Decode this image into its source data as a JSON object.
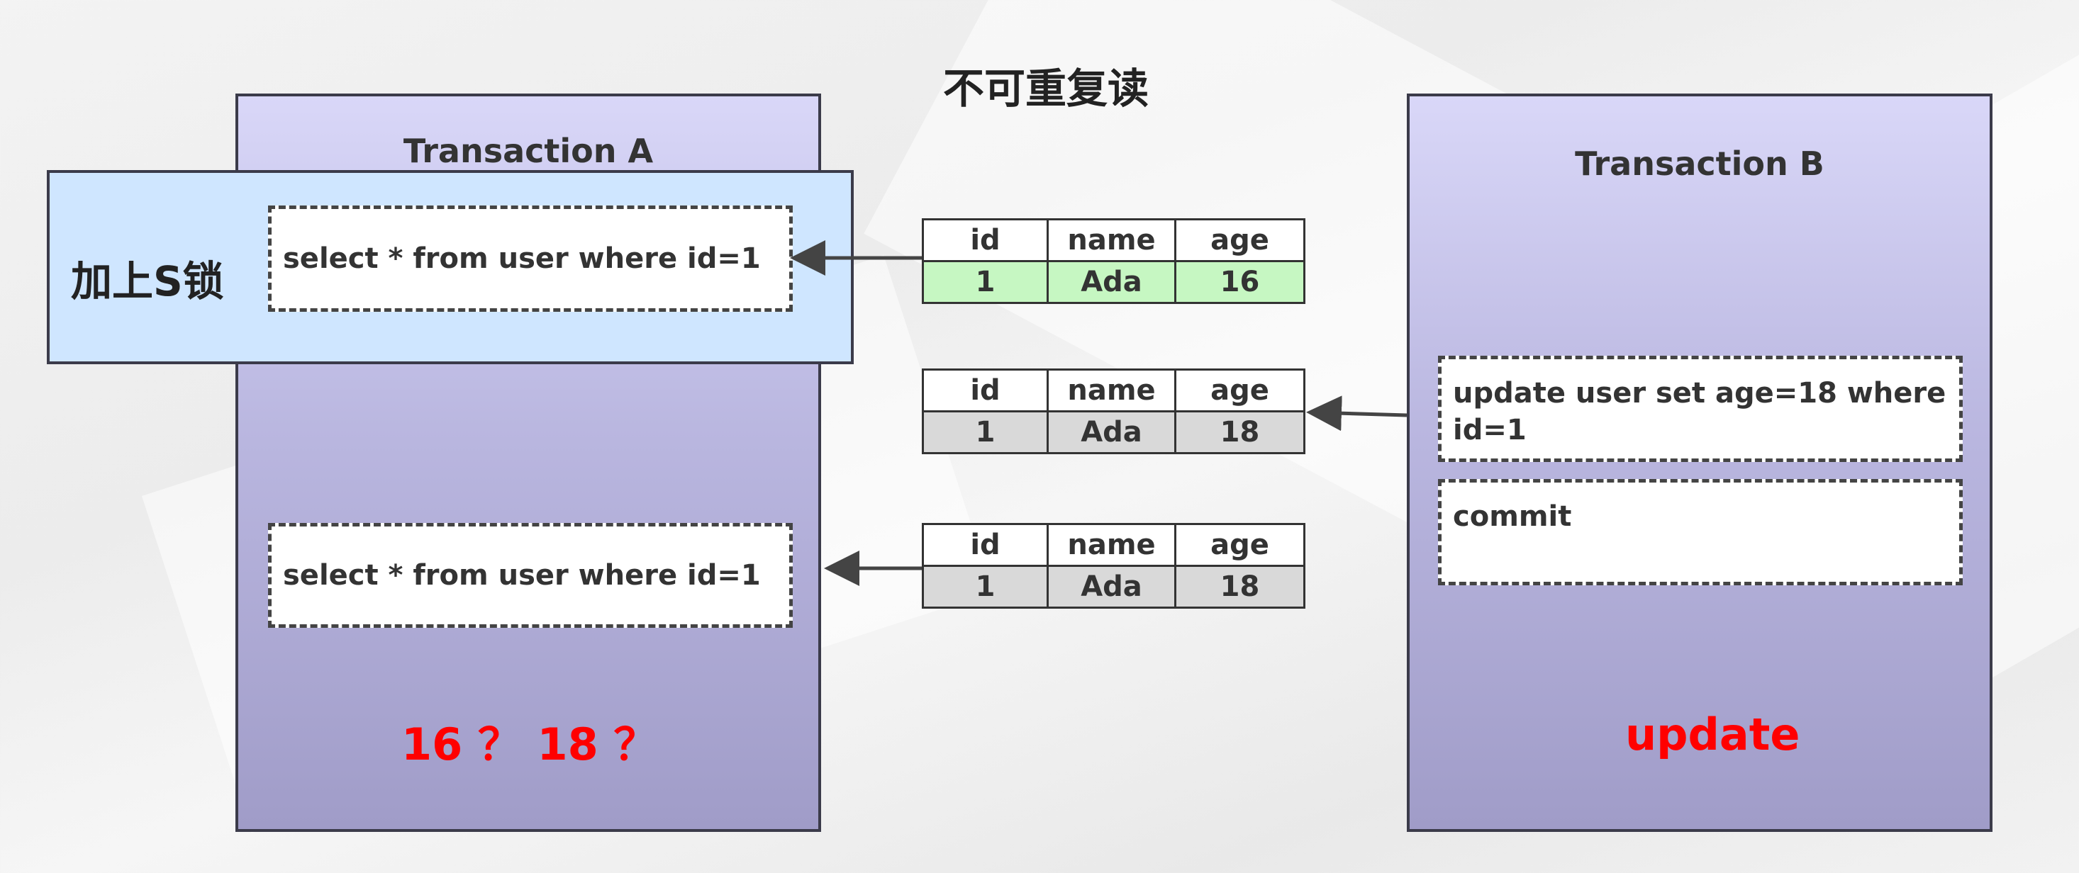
{
  "title": "不可重复读",
  "transaction_a": {
    "title": "Transaction A",
    "lock_label": "加上S锁",
    "stmt1": "select * from user where id=1",
    "stmt2": "select * from user where id=1",
    "result_text": "16 ？ 18 ？"
  },
  "transaction_b": {
    "title": "Transaction B",
    "stmt_update": "update user set age=18 where id=1",
    "stmt_commit": "commit",
    "label": "update"
  },
  "tables": [
    {
      "headers": [
        "id",
        "name",
        "age"
      ],
      "row": [
        "1",
        "Ada",
        "16"
      ],
      "row_color": "#c6f7c2"
    },
    {
      "headers": [
        "id",
        "name",
        "age"
      ],
      "row": [
        "1",
        "Ada",
        "18"
      ],
      "row_color": "#d9d9d9"
    },
    {
      "headers": [
        "id",
        "name",
        "age"
      ],
      "row": [
        "1",
        "Ada",
        "18"
      ],
      "row_color": "#d9d9d9"
    }
  ],
  "colors": {
    "accent_red": "#ff0000",
    "lock_blue": "#cfe6ff",
    "txn_purple": "#bab7e0"
  }
}
